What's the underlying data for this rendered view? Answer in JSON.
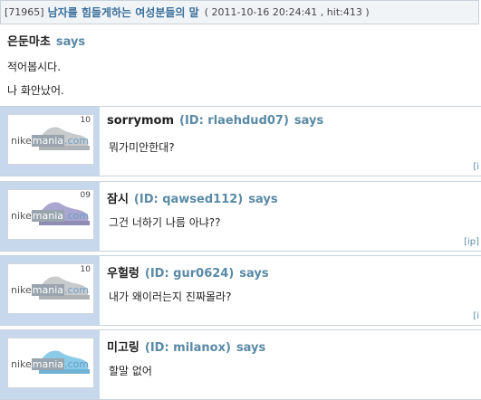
{
  "header": {
    "post_id": "[71965]",
    "title": "남자를 힘들게하는 여성분들의 말",
    "meta": "( 2011-10-16 20:24:41 , hit:413 )"
  },
  "op": {
    "author": "은둔마초",
    "says": "says",
    "lines": [
      "적어봅시다.",
      "나 화안났어."
    ]
  },
  "comments": [
    {
      "author": "sorrymom",
      "id_text": "(ID: rlaehdud07)",
      "says": "says",
      "text": "뭐가미안한대?",
      "avatar_num": "10",
      "shoe_color": "#c8cacc",
      "ip": "[i"
    },
    {
      "author": "잠시",
      "id_text": "(ID: qawsed112)",
      "says": "says",
      "text": "그건 너하기 나름 아냐??",
      "avatar_num": "09",
      "shoe_color": "#a9a6cf",
      "ip": "[ip]"
    },
    {
      "author": "우헐렁",
      "id_text": "(ID: gur0624)",
      "says": "says",
      "text": "내가 왜이러는지 진짜몰라?",
      "avatar_num": "10",
      "shoe_color": "#c8cacc",
      "ip": "[i"
    },
    {
      "author": "미고링",
      "id_text": "(ID: milanox)",
      "says": "says",
      "text": "할말 없어",
      "avatar_num": "",
      "shoe_color": "#8ccbe8",
      "ip": ""
    }
  ],
  "logo": {
    "nike": "nike",
    "mania": "mania",
    "com": ".com"
  }
}
